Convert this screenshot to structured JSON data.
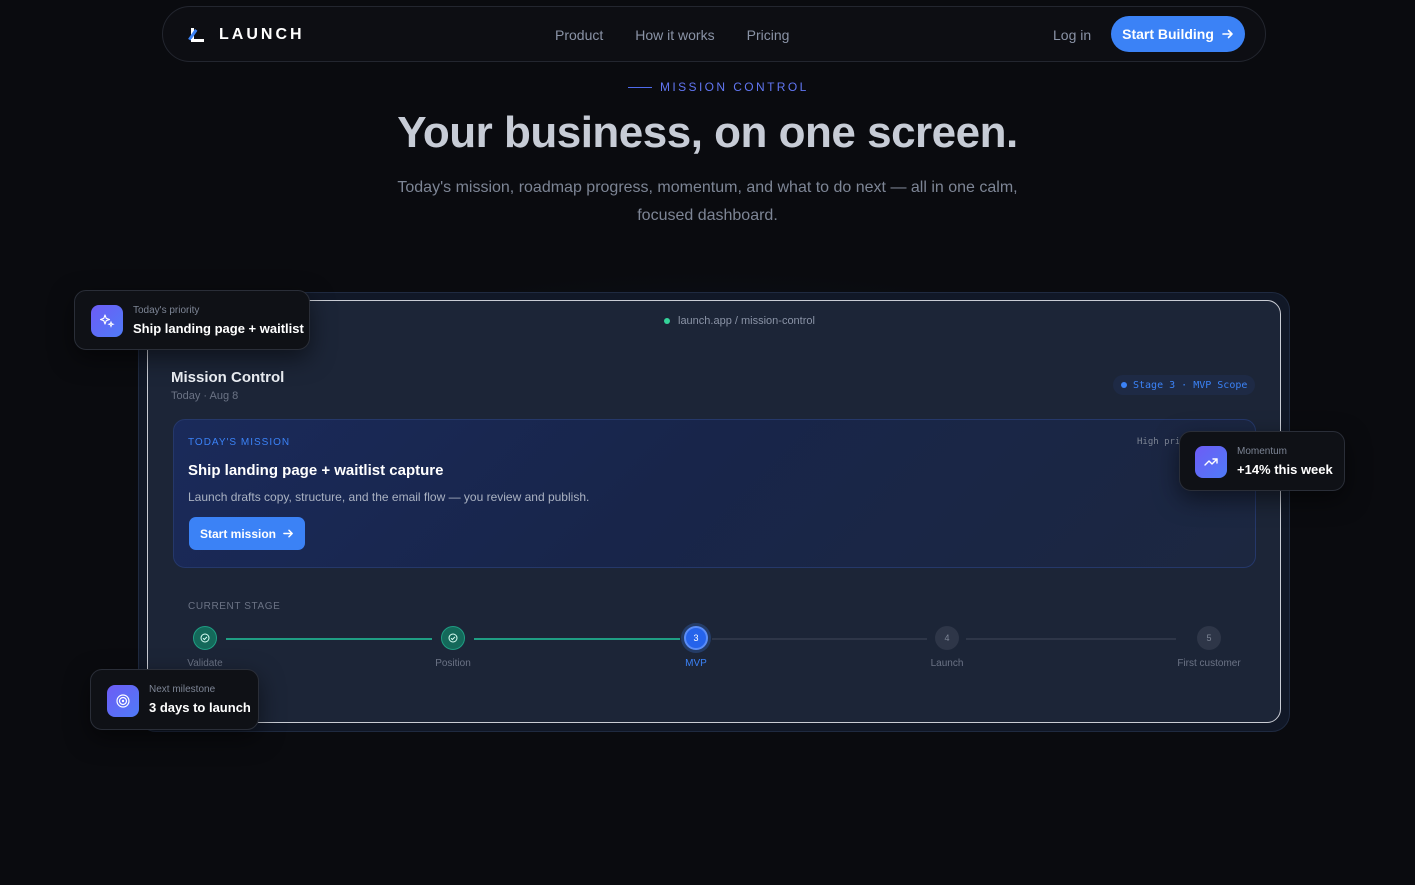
{
  "nav": {
    "brand": "LAUNCH",
    "links": [
      "Product",
      "How it works",
      "Pricing"
    ],
    "login": "Log in",
    "cta": "Start Building"
  },
  "hero": {
    "eyebrow": "MISSION CONTROL",
    "title": "Your business, on one screen.",
    "subtitle": "Today's mission, roadmap progress, momentum, and what to do next — all in one calm, focused dashboard."
  },
  "dashboard": {
    "url": "launch.app / mission-control",
    "title": "Mission Control",
    "date": "Today · Aug 8",
    "stage_badge": "Stage 3 · MVP Scope",
    "mission": {
      "eyebrow": "TODAY'S MISSION",
      "priority": "High pri",
      "title": "Ship landing page + waitlist capture",
      "description": "Launch drafts copy, structure, and the email flow — you review and publish.",
      "button": "Start mission"
    },
    "current_stage_label": "CURRENT STAGE",
    "steps": [
      {
        "num": "✓",
        "label": "Validate",
        "state": "done"
      },
      {
        "num": "✓",
        "label": "Position",
        "state": "done"
      },
      {
        "num": "3",
        "label": "MVP",
        "state": "current"
      },
      {
        "num": "4",
        "label": "Launch",
        "state": "todo"
      },
      {
        "num": "5",
        "label": "First customer",
        "state": "todo"
      }
    ]
  },
  "floating": {
    "priority": {
      "key": "Today's priority",
      "value": "Ship landing page + waitlist",
      "icon": "sparkles-icon"
    },
    "momentum": {
      "key": "Momentum",
      "value": "+14% this week",
      "icon": "trending-up-icon"
    },
    "milestone": {
      "key": "Next milestone",
      "value": "3 days to launch",
      "icon": "target-icon"
    }
  },
  "colors": {
    "accent": "#3b82f6",
    "success": "#1f9e83",
    "background": "#0a0b0f"
  }
}
